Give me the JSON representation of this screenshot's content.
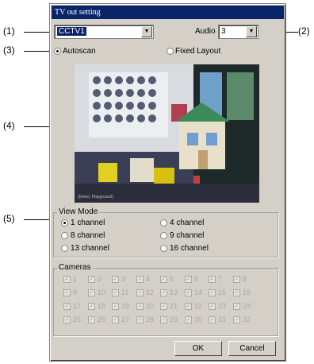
{
  "window": {
    "title": "TV out setting"
  },
  "annotations": {
    "a1": "(1)",
    "a2": "(2)",
    "a3": "(3)",
    "a4": "(4)",
    "a5": "(5)"
  },
  "source": {
    "value": "CCTV1"
  },
  "audio": {
    "label": "Audio",
    "value": "3"
  },
  "mode": {
    "autoscan": "Autoscan",
    "fixed": "Fixed Layout",
    "selected": "autoscan"
  },
  "preview": {
    "caption": "(Demo, Playground)"
  },
  "view_mode": {
    "title": "View Mode",
    "options": [
      "1 channel",
      "4 channel",
      "8 channel",
      "9 channel",
      "13 channel",
      "16 channel"
    ],
    "selected": 0
  },
  "cameras": {
    "title": "Cameras",
    "labels": [
      "1",
      "2",
      "3",
      "4",
      "5",
      "6",
      "7",
      "8",
      "9",
      "10",
      "11",
      "12",
      "13",
      "14",
      "15",
      "16",
      "17",
      "18",
      "19",
      "20",
      "21",
      "22",
      "23",
      "24",
      "25",
      "26",
      "27",
      "28",
      "29",
      "30",
      "31",
      "32"
    ]
  },
  "buttons": {
    "ok": "OK",
    "cancel": "Cancel"
  }
}
